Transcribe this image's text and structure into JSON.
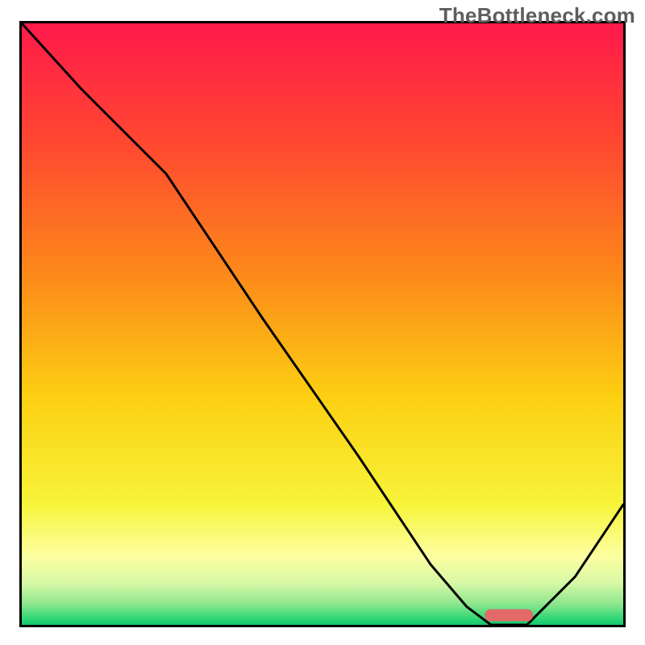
{
  "watermark": "TheBottleneck.com",
  "colors": {
    "curve": "#000000",
    "marker_fill": "#e46a6a",
    "border": "#000000"
  },
  "chart_data": {
    "type": "line",
    "title": "",
    "xlabel": "",
    "ylabel": "",
    "xlim": [
      0,
      1
    ],
    "ylim": [
      0,
      1
    ],
    "grid": false,
    "series": [
      {
        "name": "bottleneck-curve",
        "x": [
          0.0,
          0.1,
          0.24,
          0.4,
          0.56,
          0.68,
          0.74,
          0.78,
          0.84,
          0.92,
          1.0
        ],
        "values": [
          1.0,
          0.89,
          0.75,
          0.51,
          0.28,
          0.1,
          0.03,
          0.0,
          0.0,
          0.08,
          0.2
        ]
      }
    ],
    "marker": {
      "name": "target-zone",
      "x_start": 0.77,
      "x_end": 0.85,
      "y": 0.006,
      "height": 0.02
    },
    "gradient_stops": [
      {
        "pos": 0.0,
        "color": "#ff1a4b"
      },
      {
        "pos": 0.2,
        "color": "#ff4830"
      },
      {
        "pos": 0.42,
        "color": "#fc8a1a"
      },
      {
        "pos": 0.62,
        "color": "#fccf12"
      },
      {
        "pos": 0.8,
        "color": "#f7f43a"
      },
      {
        "pos": 0.885,
        "color": "#fdffa0"
      },
      {
        "pos": 0.93,
        "color": "#d8f8a6"
      },
      {
        "pos": 0.965,
        "color": "#8de78e"
      },
      {
        "pos": 0.99,
        "color": "#2fd675"
      },
      {
        "pos": 1.0,
        "color": "#11c96e"
      }
    ]
  }
}
